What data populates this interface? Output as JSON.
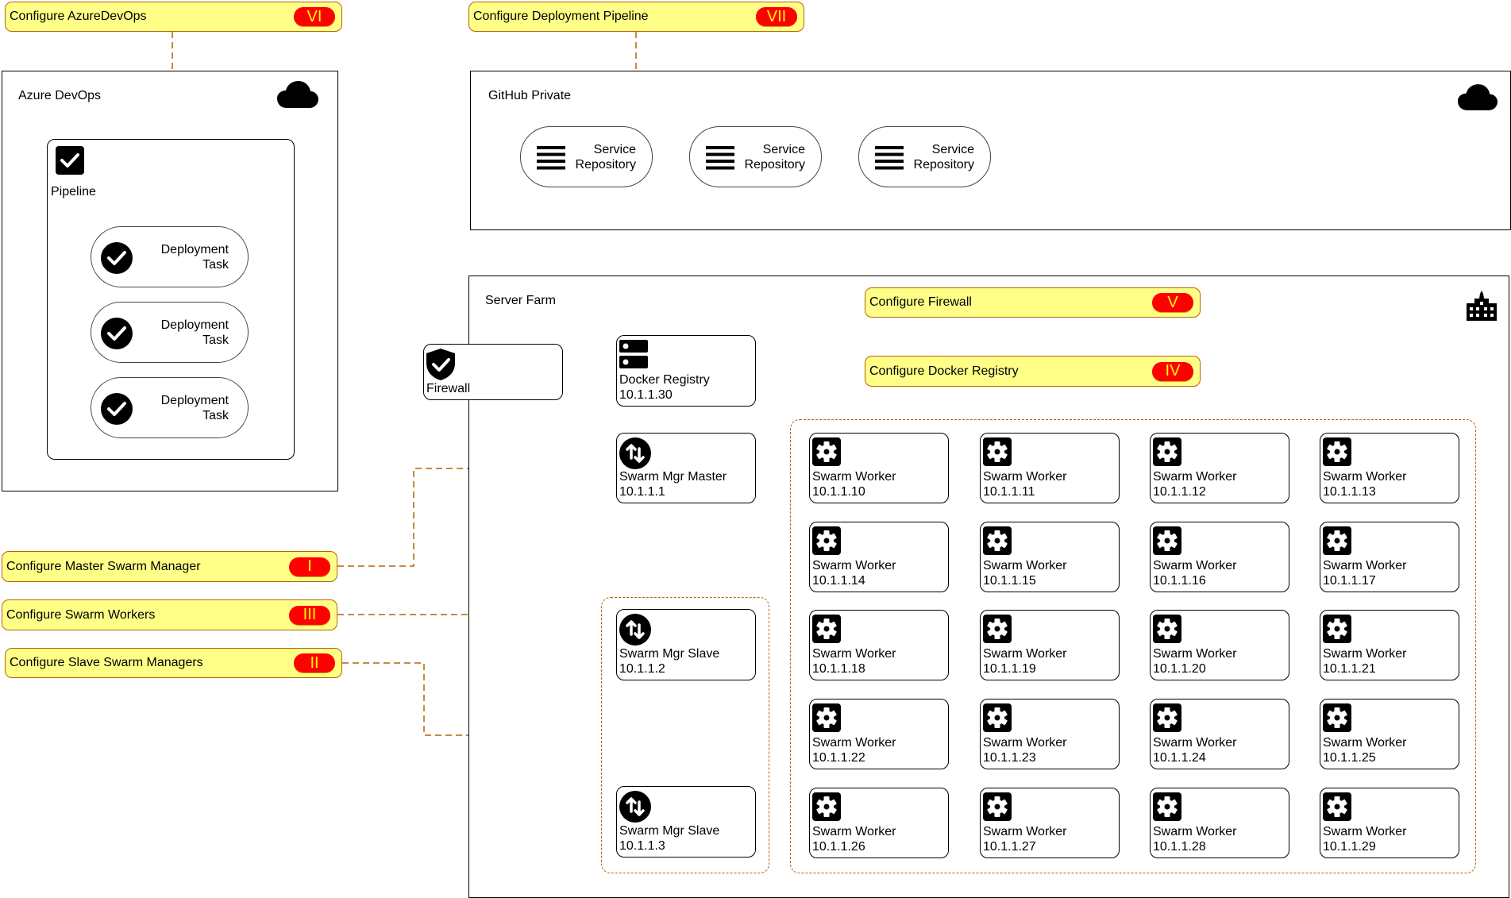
{
  "callouts": {
    "azure_devops": {
      "label": "Configure AzureDevOps",
      "step": "VI"
    },
    "deployment_pipeline": {
      "label": "Configure Deployment Pipeline",
      "step": "VII"
    },
    "firewall": {
      "label": "Configure Firewall",
      "step": "V"
    },
    "docker_registry": {
      "label": "Configure Docker Registry",
      "step": "IV"
    },
    "master_manager": {
      "label": "Configure Master Swarm Manager",
      "step": "I"
    },
    "swarm_workers": {
      "label": "Configure Swarm Workers",
      "step": "III"
    },
    "slave_managers": {
      "label": "Configure Slave Swarm Managers",
      "step": "II"
    }
  },
  "azure_devops": {
    "title": "Azure DevOps",
    "icon": "cloud-icon",
    "pipeline": {
      "label": "Pipeline",
      "icon": "checkbox-icon",
      "tasks": [
        {
          "line1": "Deployment",
          "line2": "Task"
        },
        {
          "line1": "Deployment",
          "line2": "Task"
        },
        {
          "line1": "Deployment",
          "line2": "Task"
        }
      ]
    }
  },
  "github": {
    "title": "GitHub Private",
    "icon": "cloud-icon",
    "repositories": [
      {
        "line1": "Service",
        "line2": "Repository"
      },
      {
        "line1": "Service",
        "line2": "Repository"
      },
      {
        "line1": "Service",
        "line2": "Repository"
      }
    ]
  },
  "server_farm": {
    "title": "Server Farm",
    "icon": "building-icon",
    "firewall": {
      "name": "Firewall"
    },
    "docker_registry": {
      "name": "Docker Registry",
      "ip": "10.1.1.30"
    },
    "master": {
      "name": "Swarm Mgr Master",
      "ip": "10.1.1.1"
    },
    "slaves": [
      {
        "name": "Swarm Mgr Slave",
        "ip": "10.1.1.2"
      },
      {
        "name": "Swarm Mgr Slave",
        "ip": "10.1.1.3"
      }
    ],
    "workers": [
      {
        "name": "Swarm Worker",
        "ip": "10.1.1.10"
      },
      {
        "name": "Swarm Worker",
        "ip": "10.1.1.11"
      },
      {
        "name": "Swarm Worker",
        "ip": "10.1.1.12"
      },
      {
        "name": "Swarm Worker",
        "ip": "10.1.1.13"
      },
      {
        "name": "Swarm Worker",
        "ip": "10.1.1.14"
      },
      {
        "name": "Swarm Worker",
        "ip": "10.1.1.15"
      },
      {
        "name": "Swarm Worker",
        "ip": "10.1.1.16"
      },
      {
        "name": "Swarm Worker",
        "ip": "10.1.1.17"
      },
      {
        "name": "Swarm Worker",
        "ip": "10.1.1.18"
      },
      {
        "name": "Swarm Worker",
        "ip": "10.1.1.19"
      },
      {
        "name": "Swarm Worker",
        "ip": "10.1.1.20"
      },
      {
        "name": "Swarm Worker",
        "ip": "10.1.1.21"
      },
      {
        "name": "Swarm Worker",
        "ip": "10.1.1.22"
      },
      {
        "name": "Swarm Worker",
        "ip": "10.1.1.23"
      },
      {
        "name": "Swarm Worker",
        "ip": "10.1.1.24"
      },
      {
        "name": "Swarm Worker",
        "ip": "10.1.1.25"
      },
      {
        "name": "Swarm Worker",
        "ip": "10.1.1.26"
      },
      {
        "name": "Swarm Worker",
        "ip": "10.1.1.27"
      },
      {
        "name": "Swarm Worker",
        "ip": "10.1.1.28"
      },
      {
        "name": "Swarm Worker",
        "ip": "10.1.1.29"
      }
    ]
  },
  "colors": {
    "callout_fill": "#ffff88",
    "callout_border": "#b46504",
    "badge_fill": "#ff0000",
    "badge_text": "#ffff00",
    "connector": "#b46504"
  }
}
